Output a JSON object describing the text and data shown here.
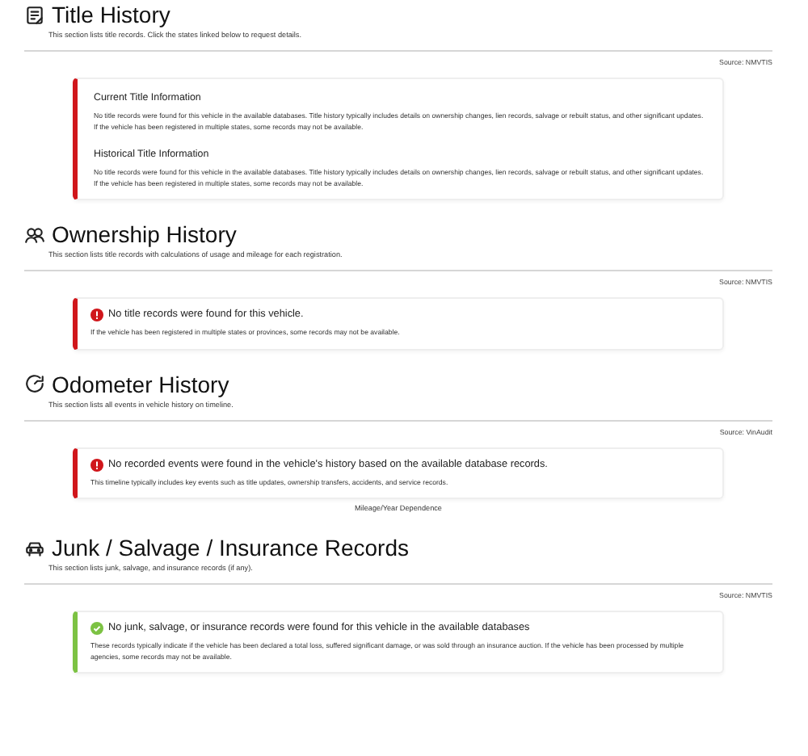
{
  "sections": [
    {
      "title": "Title History",
      "subtitle": "This section lists title records. Click the states linked below to request details.",
      "source": "Source: NMVTIS",
      "card": {
        "color": "#d0161b",
        "kind": "info",
        "blocks": [
          {
            "heading": "Current Title Information",
            "text": "No title records were found for this vehicle in the available databases. Title history typically includes details on ownership changes, lien records, salvage or rebuilt status, and other significant updates. If the vehicle has been registered in multiple states, some records may not be available."
          },
          {
            "heading": "Historical Title Information",
            "text": "No title records were found for this vehicle in the available databases. Title history typically includes details on ownership changes, lien records, salvage or rebuilt status, and other significant updates. If the vehicle has been registered in multiple states, some records may not be available."
          }
        ]
      }
    },
    {
      "title": "Ownership History",
      "subtitle": "This section lists title records with calculations of usage and mileage for each registration.",
      "source": "Source: NMVTIS",
      "card": {
        "color": "#d0161b",
        "kind": "error",
        "message": "No title records were found for this vehicle.",
        "text": "If the vehicle has been registered in multiple states or provinces, some records may not be available."
      }
    },
    {
      "title": "Odometer History",
      "subtitle": "This section lists all events in vehicle history on timeline.",
      "source": "Source: VinAudit",
      "card": {
        "color": "#d0161b",
        "kind": "error",
        "message": "No recorded events were found in the vehicle's history based on the available database records.",
        "text": "This timeline typically includes key events such as title updates, ownership transfers, accidents, and service records."
      },
      "caption": "Mileage/Year Dependence"
    },
    {
      "title": "Junk / Salvage / Insurance Records",
      "subtitle": "This section lists junk, salvage, and insurance records (if any).",
      "source": "Source: NMVTIS",
      "card": {
        "color": "#7cc243",
        "kind": "success",
        "message": "No junk, salvage, or insurance records were found for this vehicle in the available databases",
        "text": "These records typically indicate if the vehicle has been declared a total loss, suffered significant damage, or was sold through an insurance auction. If the vehicle has been processed by multiple agencies, some records may not be available."
      }
    }
  ]
}
